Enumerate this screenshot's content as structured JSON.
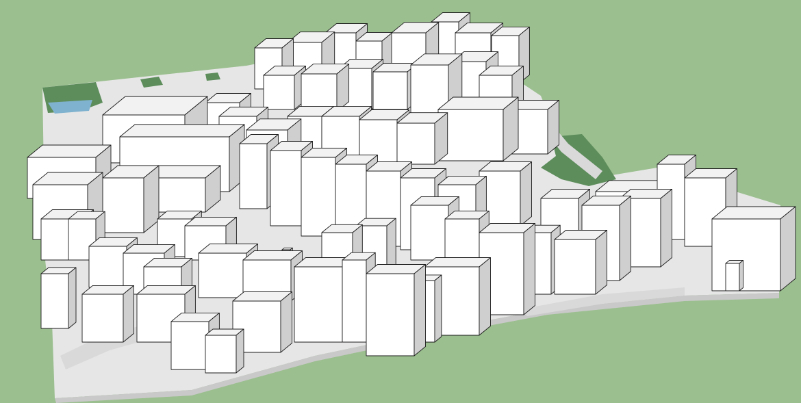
{
  "scene": {
    "kind": "3d-city-block-model",
    "colors": {
      "background": "#9bbf8f",
      "ground_base": "#e6e6e6",
      "ground_shadow": "#c9c9c9",
      "street": "#d9d9d9",
      "park": "#5d8d5b",
      "water": "#7fb2cf",
      "roof": "#f2f2f2",
      "wall_lit": "#ffffff",
      "wall_shade": "#cfcfcf",
      "wall_dark": "#b5b5b5",
      "edge": "#1a1a1a"
    }
  }
}
